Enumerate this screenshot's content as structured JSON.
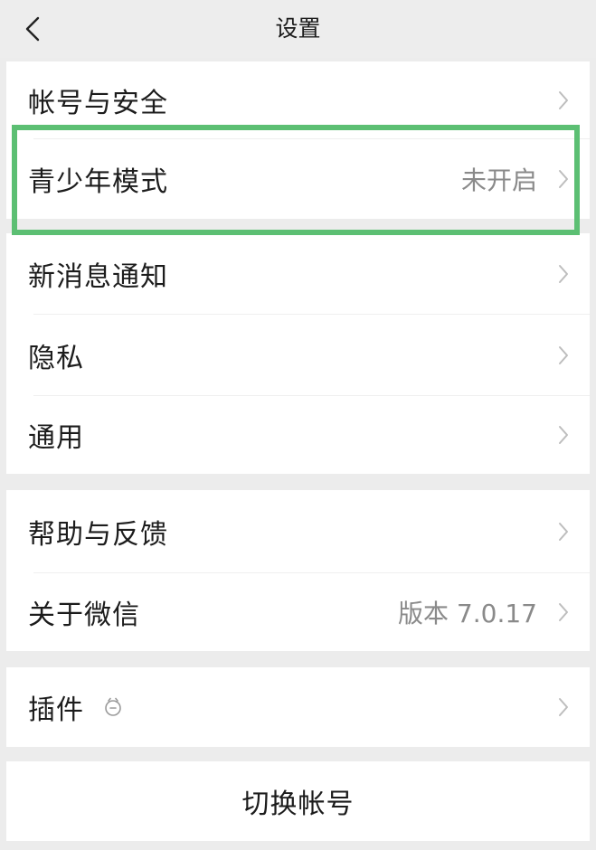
{
  "header": {
    "title": "设置",
    "back_icon": "chevron-left-icon"
  },
  "groups": [
    {
      "items": [
        {
          "label": "帐号与安全",
          "value": ""
        },
        {
          "label": "青少年模式",
          "value": "未开启",
          "highlighted": true
        }
      ]
    },
    {
      "items": [
        {
          "label": "新消息通知",
          "value": ""
        },
        {
          "label": "隐私",
          "value": ""
        },
        {
          "label": "通用",
          "value": ""
        }
      ]
    },
    {
      "items": [
        {
          "label": "帮助与反馈",
          "value": ""
        },
        {
          "label": "关于微信",
          "value": "版本 7.0.17"
        }
      ]
    },
    {
      "items": [
        {
          "label": "插件",
          "value": "",
          "icon": "plugin-icon"
        }
      ]
    }
  ],
  "switch_account": {
    "label": "切换帐号"
  },
  "colors": {
    "background": "#ececec",
    "row": "#ffffff",
    "highlight": "#5cbf73",
    "secondary_text": "#8a8a8a"
  }
}
